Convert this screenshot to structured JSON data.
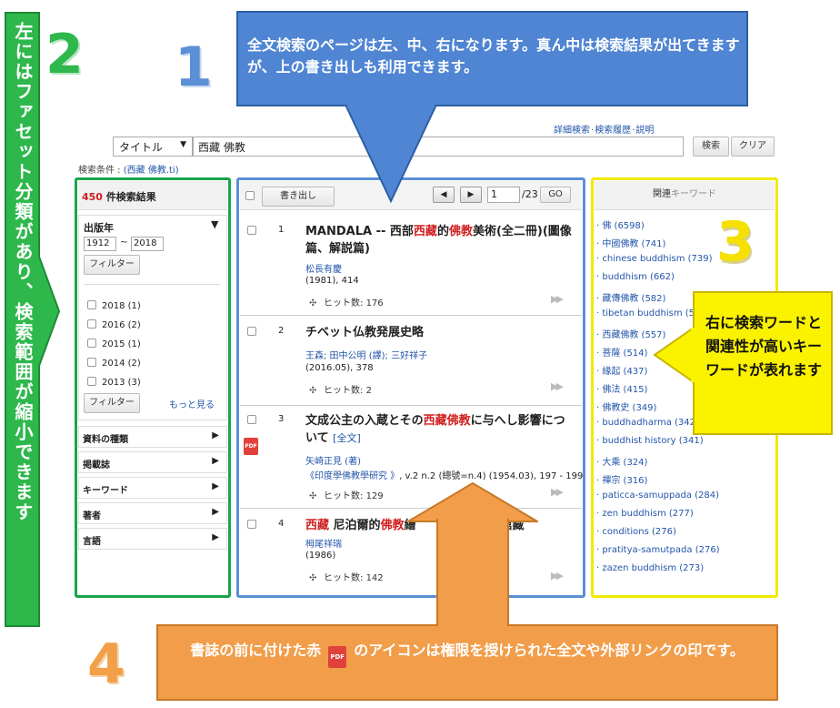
{
  "callouts": {
    "blue": "全文検索のページは左、中、右になります。真ん中は検索結果が出てきますが、上の書き出しも利用できます。",
    "left": "左にはファセット分類があり、検索範囲が縮小できます",
    "right": "右に検索ワードと関連性が高いキーワードが表れます",
    "bottom_before": "書誌の前に付けた赤",
    "bottom_after": "のアイコンは権限を授けられた全文や外部リンクの印です。",
    "numbers": [
      "1",
      "2",
      "3",
      "4"
    ]
  },
  "header": {
    "links": [
      "詳細検索",
      "検索履歴",
      "説明"
    ],
    "field_select": "タイトル",
    "query": "西藏 佛教",
    "search_label": "検索",
    "clear_label": "クリア",
    "condition_label": "検索条件 :",
    "condition_value": "(西藏 佛教.ti)"
  },
  "facets": {
    "count": "450",
    "count_suffix": "件検索結果",
    "year_title": "出版年",
    "year_from": "1912",
    "year_to": "2018",
    "tilde": "~",
    "filter_label": "フィルター",
    "years": [
      "2018 (1)",
      "2016 (2)",
      "2015 (1)",
      "2014 (2)",
      "2013 (3)"
    ],
    "more": "もっと見る",
    "groups": [
      "資料の種類",
      "掲載誌",
      "キーワード",
      "著者",
      "言語"
    ]
  },
  "results": {
    "export_label": "書き出し",
    "page": "1",
    "total_pages": "/23",
    "go": "GO",
    "hits_label": "ヒット数:",
    "items": [
      {
        "num": "1",
        "title_a": "MANDALA -- 西部",
        "hl1": "西藏",
        "title_b": "的",
        "hl2": "佛教",
        "title_c": "美術(全二冊)(圖像篇、解説篇)",
        "author": "松長有慶",
        "meta": "(1981), 414",
        "hits": "176"
      },
      {
        "num": "2",
        "title_a": "チベット仏教発展史略",
        "author": "王森; 田中公明 (譯); 三好祥子",
        "meta": "(2016.05), 378",
        "hits": "2"
      },
      {
        "num": "3",
        "title_a": "文成公主の入蔵とその",
        "hl1": "西藏",
        "hl2": "佛教",
        "title_c": "に与へし影響について",
        "fulltext": "[全文]",
        "author": "矢崎正見 (著)",
        "journal": "《印度學佛教學研究 》",
        "meta": ", v.2 n.2 (總號=n.4) (1954.03), 197 - 199",
        "hits": "129",
        "pdf": "PDF"
      },
      {
        "num": "4",
        "hl1": "西藏",
        "title_b": " 尼泊爾的",
        "hl2": "佛教",
        "title_c": "繪",
        "title_d": "術館藏",
        "author": "栂尾祥瑞",
        "meta": "(1986)",
        "hits": "142"
      }
    ]
  },
  "keywords": {
    "title_a": "関連",
    "title_b": "キーワード",
    "items": [
      "佛 (6598)",
      "中國佛教 (741)",
      "chinese buddhism (739)",
      "buddhism (662)",
      "藏傳佛教 (582)",
      "tibetan buddhism (571",
      "西藏佛教 (557)",
      "菩薩 (514)",
      "緣起 (437)",
      "佛法 (415)",
      "佛教史 (349)",
      "buddhadharma (342)",
      "buddhist history (341)",
      "大乘 (324)",
      "禪宗 (316)",
      "paticca-samuppada (284)",
      "zen buddhism (277)",
      "conditions (276)",
      "pratitya-samutpada (276)",
      "zazen buddhism (273)"
    ]
  },
  "colors": {
    "green": "#19a54a",
    "blue": "#5b8fd6",
    "yellow": "#f0ea00",
    "orange": "#f19d4a",
    "red": "#d02020",
    "link": "#2255aa"
  }
}
